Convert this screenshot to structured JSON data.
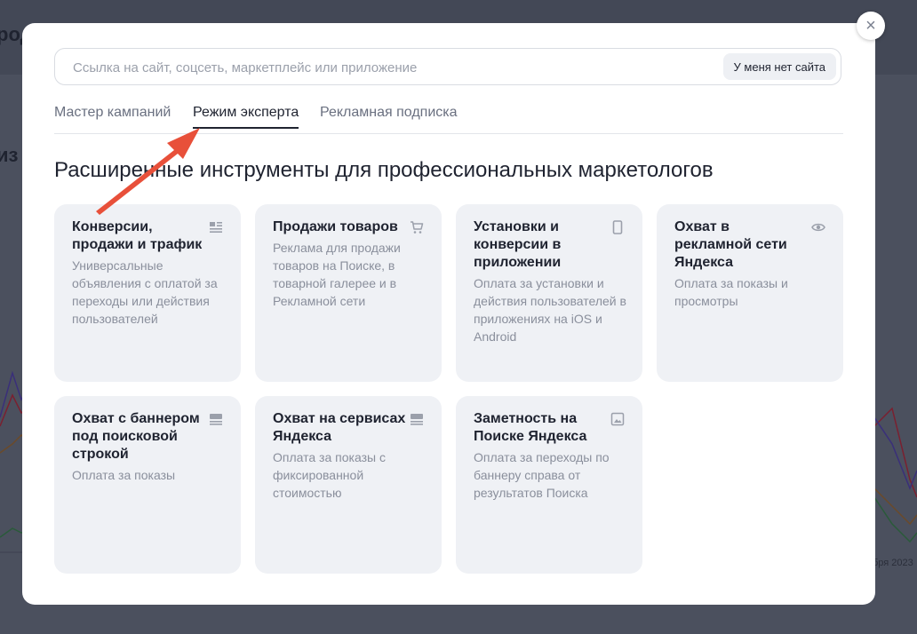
{
  "background": {
    "fragment_1": "род",
    "fragment_2": "из",
    "fragment_3": "бря 2023"
  },
  "modal": {
    "close_label": "×",
    "search": {
      "placeholder": "Ссылка на сайт, соцсеть, маркетплейс или приложение",
      "value": "",
      "no_site_button": "У меня нет сайта"
    },
    "tabs": [
      {
        "label": "Мастер кампаний",
        "active": false
      },
      {
        "label": "Режим эксперта",
        "active": true
      },
      {
        "label": "Рекламная подписка",
        "active": false
      }
    ],
    "heading": "Расширенные инструменты для профессиональных маркетологов",
    "cards": [
      {
        "title": "Конверсии, продажи и трафик",
        "description": "Универсальные объявления с оплатой за переходы или действия пользователей",
        "icon": "text-lines-icon"
      },
      {
        "title": "Продажи товаров",
        "description": "Реклама для продажи товаров на Поиске, в товарной галерее и в Рекламной сети",
        "icon": "cart-icon"
      },
      {
        "title": "Установки и конверсии в приложении",
        "description": "Оплата за установки и действия пользователей в приложениях на iOS и Android",
        "icon": "phone-icon"
      },
      {
        "title": "Охват в рекламной сети Яндекса",
        "description": "Оплата за показы и просмотры",
        "icon": "eye-icon"
      },
      {
        "title": "Охват с баннером под поисковой строкой",
        "description": "Оплата за показы",
        "icon": "banner-icon"
      },
      {
        "title": "Охват на сервисах Яндекса",
        "description": "Оплата за показы с фиксированной стоимостью",
        "icon": "banner-icon"
      },
      {
        "title": "Заметность на Поиске Яндекса",
        "description": "Оплата за переходы по баннеру справа от результатов Поиска",
        "icon": "image-icon"
      }
    ],
    "annotation_arrow_color": "#e8503a"
  }
}
